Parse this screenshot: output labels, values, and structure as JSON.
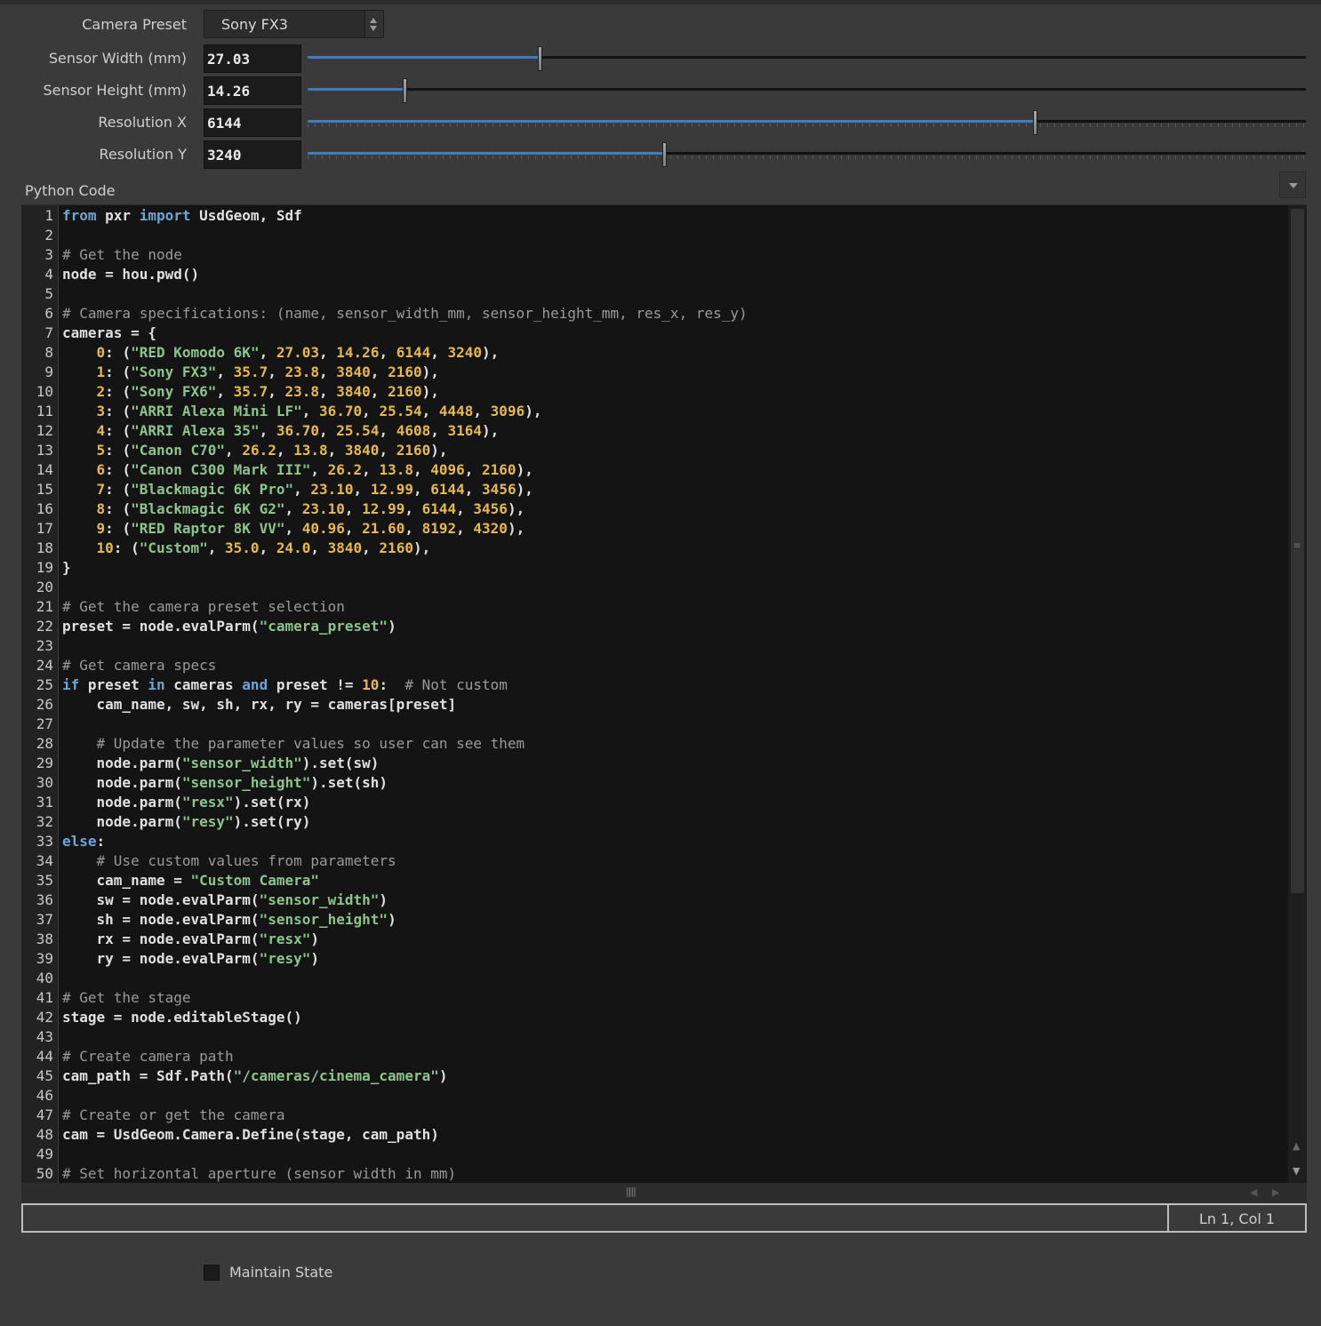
{
  "params": {
    "camera_preset": {
      "label": "Camera Preset",
      "value": "Sony FX3"
    },
    "sensor_width": {
      "label": "Sensor Width (mm)",
      "value": "27.03",
      "slider_fraction": 0.232
    },
    "sensor_height": {
      "label": "Sensor Height (mm)",
      "value": "14.26",
      "slider_fraction": 0.097
    },
    "res_x": {
      "label": "Resolution X",
      "value": "6144",
      "slider_fraction": 0.728
    },
    "res_y": {
      "label": "Resolution Y",
      "value": "3240",
      "slider_fraction": 0.357
    }
  },
  "code_editor": {
    "title": "Python Code",
    "lines": [
      [
        [
          "kw",
          "from"
        ],
        [
          "t",
          " pxr "
        ],
        [
          "kw",
          "import"
        ],
        [
          "t",
          " UsdGeom, Sdf"
        ]
      ],
      [],
      [
        [
          "cm",
          "# Get the node"
        ]
      ],
      [
        [
          "t",
          "node = hou.pwd()"
        ]
      ],
      [],
      [
        [
          "cm",
          "# Camera specifications: (name, sensor_width_mm, sensor_height_mm, res_x, res_y)"
        ]
      ],
      [
        [
          "t",
          "cameras = {"
        ]
      ],
      [
        [
          "t",
          "    "
        ],
        [
          "nm",
          "0"
        ],
        [
          "t",
          ": ("
        ],
        [
          "st",
          "\"RED Komodo 6K\""
        ],
        [
          "t",
          ", "
        ],
        [
          "nm",
          "27.03"
        ],
        [
          "t",
          ", "
        ],
        [
          "nm",
          "14.26"
        ],
        [
          "t",
          ", "
        ],
        [
          "nm",
          "6144"
        ],
        [
          "t",
          ", "
        ],
        [
          "nm",
          "3240"
        ],
        [
          "t",
          "),"
        ]
      ],
      [
        [
          "t",
          "    "
        ],
        [
          "nm",
          "1"
        ],
        [
          "t",
          ": ("
        ],
        [
          "st",
          "\"Sony FX3\""
        ],
        [
          "t",
          ", "
        ],
        [
          "nm",
          "35.7"
        ],
        [
          "t",
          ", "
        ],
        [
          "nm",
          "23.8"
        ],
        [
          "t",
          ", "
        ],
        [
          "nm",
          "3840"
        ],
        [
          "t",
          ", "
        ],
        [
          "nm",
          "2160"
        ],
        [
          "t",
          "),"
        ]
      ],
      [
        [
          "t",
          "    "
        ],
        [
          "nm",
          "2"
        ],
        [
          "t",
          ": ("
        ],
        [
          "st",
          "\"Sony FX6\""
        ],
        [
          "t",
          ", "
        ],
        [
          "nm",
          "35.7"
        ],
        [
          "t",
          ", "
        ],
        [
          "nm",
          "23.8"
        ],
        [
          "t",
          ", "
        ],
        [
          "nm",
          "3840"
        ],
        [
          "t",
          ", "
        ],
        [
          "nm",
          "2160"
        ],
        [
          "t",
          "),"
        ]
      ],
      [
        [
          "t",
          "    "
        ],
        [
          "nm",
          "3"
        ],
        [
          "t",
          ": ("
        ],
        [
          "st",
          "\"ARRI Alexa Mini LF\""
        ],
        [
          "t",
          ", "
        ],
        [
          "nm",
          "36.70"
        ],
        [
          "t",
          ", "
        ],
        [
          "nm",
          "25.54"
        ],
        [
          "t",
          ", "
        ],
        [
          "nm",
          "4448"
        ],
        [
          "t",
          ", "
        ],
        [
          "nm",
          "3096"
        ],
        [
          "t",
          "),"
        ]
      ],
      [
        [
          "t",
          "    "
        ],
        [
          "nm",
          "4"
        ],
        [
          "t",
          ": ("
        ],
        [
          "st",
          "\"ARRI Alexa 35\""
        ],
        [
          "t",
          ", "
        ],
        [
          "nm",
          "36.70"
        ],
        [
          "t",
          ", "
        ],
        [
          "nm",
          "25.54"
        ],
        [
          "t",
          ", "
        ],
        [
          "nm",
          "4608"
        ],
        [
          "t",
          ", "
        ],
        [
          "nm",
          "3164"
        ],
        [
          "t",
          "),"
        ]
      ],
      [
        [
          "t",
          "    "
        ],
        [
          "nm",
          "5"
        ],
        [
          "t",
          ": ("
        ],
        [
          "st",
          "\"Canon C70\""
        ],
        [
          "t",
          ", "
        ],
        [
          "nm",
          "26.2"
        ],
        [
          "t",
          ", "
        ],
        [
          "nm",
          "13.8"
        ],
        [
          "t",
          ", "
        ],
        [
          "nm",
          "3840"
        ],
        [
          "t",
          ", "
        ],
        [
          "nm",
          "2160"
        ],
        [
          "t",
          "),"
        ]
      ],
      [
        [
          "t",
          "    "
        ],
        [
          "nm",
          "6"
        ],
        [
          "t",
          ": ("
        ],
        [
          "st",
          "\"Canon C300 Mark III\""
        ],
        [
          "t",
          ", "
        ],
        [
          "nm",
          "26.2"
        ],
        [
          "t",
          ", "
        ],
        [
          "nm",
          "13.8"
        ],
        [
          "t",
          ", "
        ],
        [
          "nm",
          "4096"
        ],
        [
          "t",
          ", "
        ],
        [
          "nm",
          "2160"
        ],
        [
          "t",
          "),"
        ]
      ],
      [
        [
          "t",
          "    "
        ],
        [
          "nm",
          "7"
        ],
        [
          "t",
          ": ("
        ],
        [
          "st",
          "\"Blackmagic 6K Pro\""
        ],
        [
          "t",
          ", "
        ],
        [
          "nm",
          "23.10"
        ],
        [
          "t",
          ", "
        ],
        [
          "nm",
          "12.99"
        ],
        [
          "t",
          ", "
        ],
        [
          "nm",
          "6144"
        ],
        [
          "t",
          ", "
        ],
        [
          "nm",
          "3456"
        ],
        [
          "t",
          "),"
        ]
      ],
      [
        [
          "t",
          "    "
        ],
        [
          "nm",
          "8"
        ],
        [
          "t",
          ": ("
        ],
        [
          "st",
          "\"Blackmagic 6K G2\""
        ],
        [
          "t",
          ", "
        ],
        [
          "nm",
          "23.10"
        ],
        [
          "t",
          ", "
        ],
        [
          "nm",
          "12.99"
        ],
        [
          "t",
          ", "
        ],
        [
          "nm",
          "6144"
        ],
        [
          "t",
          ", "
        ],
        [
          "nm",
          "3456"
        ],
        [
          "t",
          "),"
        ]
      ],
      [
        [
          "t",
          "    "
        ],
        [
          "nm",
          "9"
        ],
        [
          "t",
          ": ("
        ],
        [
          "st",
          "\"RED Raptor 8K VV\""
        ],
        [
          "t",
          ", "
        ],
        [
          "nm",
          "40.96"
        ],
        [
          "t",
          ", "
        ],
        [
          "nm",
          "21.60"
        ],
        [
          "t",
          ", "
        ],
        [
          "nm",
          "8192"
        ],
        [
          "t",
          ", "
        ],
        [
          "nm",
          "4320"
        ],
        [
          "t",
          "),"
        ]
      ],
      [
        [
          "t",
          "    "
        ],
        [
          "nm",
          "10"
        ],
        [
          "t",
          ": ("
        ],
        [
          "st",
          "\"Custom\""
        ],
        [
          "t",
          ", "
        ],
        [
          "nm",
          "35.0"
        ],
        [
          "t",
          ", "
        ],
        [
          "nm",
          "24.0"
        ],
        [
          "t",
          ", "
        ],
        [
          "nm",
          "3840"
        ],
        [
          "t",
          ", "
        ],
        [
          "nm",
          "2160"
        ],
        [
          "t",
          "),"
        ]
      ],
      [
        [
          "t",
          "}"
        ]
      ],
      [],
      [
        [
          "cm",
          "# Get the camera preset selection"
        ]
      ],
      [
        [
          "t",
          "preset = node.evalParm("
        ],
        [
          "st",
          "\"camera_preset\""
        ],
        [
          "t",
          ")"
        ]
      ],
      [],
      [
        [
          "cm",
          "# Get camera specs"
        ]
      ],
      [
        [
          "kw",
          "if"
        ],
        [
          "t",
          " preset "
        ],
        [
          "kw",
          "in"
        ],
        [
          "t",
          " cameras "
        ],
        [
          "kw",
          "and"
        ],
        [
          "t",
          " preset != "
        ],
        [
          "nm",
          "10"
        ],
        [
          "t",
          ":  "
        ],
        [
          "cm",
          "# Not custom"
        ]
      ],
      [
        [
          "t",
          "    cam_name, sw, sh, rx, ry = cameras[preset]"
        ]
      ],
      [],
      [
        [
          "t",
          "    "
        ],
        [
          "cm",
          "# Update the parameter values so user can see them"
        ]
      ],
      [
        [
          "t",
          "    node.parm("
        ],
        [
          "st",
          "\"sensor_width\""
        ],
        [
          "t",
          ").set(sw)"
        ]
      ],
      [
        [
          "t",
          "    node.parm("
        ],
        [
          "st",
          "\"sensor_height\""
        ],
        [
          "t",
          ").set(sh)"
        ]
      ],
      [
        [
          "t",
          "    node.parm("
        ],
        [
          "st",
          "\"resx\""
        ],
        [
          "t",
          ").set(rx)"
        ]
      ],
      [
        [
          "t",
          "    node.parm("
        ],
        [
          "st",
          "\"resy\""
        ],
        [
          "t",
          ").set(ry)"
        ]
      ],
      [
        [
          "kw",
          "else"
        ],
        [
          "t",
          ":"
        ]
      ],
      [
        [
          "t",
          "    "
        ],
        [
          "cm",
          "# Use custom values from parameters"
        ]
      ],
      [
        [
          "t",
          "    cam_name = "
        ],
        [
          "st",
          "\"Custom Camera\""
        ]
      ],
      [
        [
          "t",
          "    sw = node.evalParm("
        ],
        [
          "st",
          "\"sensor_width\""
        ],
        [
          "t",
          ")"
        ]
      ],
      [
        [
          "t",
          "    sh = node.evalParm("
        ],
        [
          "st",
          "\"sensor_height\""
        ],
        [
          "t",
          ")"
        ]
      ],
      [
        [
          "t",
          "    rx = node.evalParm("
        ],
        [
          "st",
          "\"resx\""
        ],
        [
          "t",
          ")"
        ]
      ],
      [
        [
          "t",
          "    ry = node.evalParm("
        ],
        [
          "st",
          "\"resy\""
        ],
        [
          "t",
          ")"
        ]
      ],
      [],
      [
        [
          "cm",
          "# Get the stage"
        ]
      ],
      [
        [
          "t",
          "stage = node.editableStage()"
        ]
      ],
      [],
      [
        [
          "cm",
          "# Create camera path"
        ]
      ],
      [
        [
          "t",
          "cam_path = Sdf.Path("
        ],
        [
          "st",
          "\"/cameras/cinema_camera\""
        ],
        [
          "t",
          ")"
        ]
      ],
      [],
      [
        [
          "cm",
          "# Create or get the camera"
        ]
      ],
      [
        [
          "t",
          "cam = UsdGeom.Camera.Define(stage, cam_path)"
        ]
      ],
      [],
      [
        [
          "cm",
          "# Set horizontal aperture (sensor width in mm)"
        ]
      ]
    ],
    "cursor_position": "Ln 1, Col 1"
  },
  "maintain_state": {
    "label": "Maintain State",
    "checked": false
  },
  "icons": {
    "preset_spinner": "up-down-arrows-icon",
    "menu": "triangle-down-icon"
  },
  "colors": {
    "keyword": "#6fa6d6",
    "comment": "#9a9a9a",
    "string": "#8cc48c",
    "number": "#e7b94a",
    "slider_fill": "#3f7cc0"
  }
}
